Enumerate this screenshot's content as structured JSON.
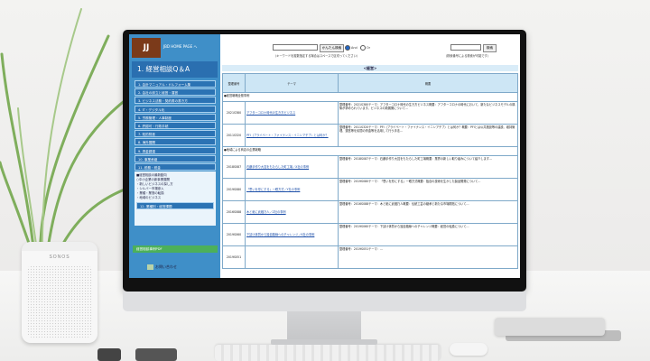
{
  "speaker": {
    "brand": "SONOS"
  },
  "sidebar": {
    "logo": "JJ",
    "home_link": "JBD HOME PAGE へ",
    "nav_title": "1. 経営相談Q＆A",
    "items": [
      "1. 会計マニュアル・ドルフォーム集",
      "2. 会社の設立と経営・運営",
      "3. ビジネス法務・契約書の書き方",
      "4. IT・デジタル化",
      "5. 労務管理・人事制度",
      "6. 許認可・行政手続",
      "7. 知的財産",
      "8. 海外展開",
      "9. 資金調達",
      "10. 事業承継",
      "11. 税務・税金",
      "12. 業種別・経営課題"
    ],
    "panel_lines": [
      "■経営相談の最新動向",
      "○中小企業の新事業展開",
      "・新しいビジネスの探し方",
      "・シルバー市場参入",
      "・業種・業態の転換",
      "・地域のビジネス"
    ],
    "green_button": "経営相談事例PDF",
    "contact": "お問い合わせ"
  },
  "search": {
    "button": "かんたん検索",
    "and_label": "And",
    "or_label": "Or",
    "note": "（キーワードを複数指定する場合はスペースで区切ってください）",
    "button2": "検索",
    "note2": "（検索番号による検索が可能です）"
  },
  "section_title": "<経営>",
  "table": {
    "col_id": "整理番号",
    "col_theme": "テーマ",
    "col_summary": "概要",
    "rows": [
      {
        "type": "cat",
        "label": "●経営戦略全般事例"
      },
      {
        "type": "row",
        "id": "2021S380",
        "theme": "アフターコロナ時代の生き方ビジネス",
        "summary": "整理番号：2021S380テーマ：アフターコロナ時代の生き方ビジネス概要：アフターコロナの時代において、新たなビジネスモデルの構築が求められています。ビジネスの新展開について…"
      },
      {
        "type": "row",
        "id": "2011S320",
        "theme": "PFI（プライベート・ファイナンス・イニシアチブ）とは何か？",
        "summary": "整理番号：2011S320テーマ：PFI（プライベート・ファイナンス・イニシアチブ）とは何か？概要：PFIとは公共施設等の建設、維持管理、運営等を民間の資金等を活用して行う手法…"
      },
      {
        "type": "cat",
        "label": "●地域による商店の企業戦略"
      },
      {
        "type": "row",
        "id": "2018S087",
        "theme": "石鹸手作り大賞をもたらした町工場／X社の事例",
        "summary": "整理番号：2018S087テーマ：石鹸手作り大賞をもたらした町工場概要：業界の新しい取り組みについて紹介します…"
      },
      {
        "type": "row",
        "id": "2019S080",
        "theme": "「思いを形にする」一眼方式／Y社の事例",
        "summary": "整理番号：2019S080テーマ：「思いを形にする」一眼方式概要：独自の技術を生かした製品開発について…"
      },
      {
        "type": "row",
        "id": "2016S088",
        "theme": "木と紙に武蔵乃人／Z社の事例",
        "summary": "整理番号：2016S088テーマ：木と紙に武蔵乃人概要：伝統工芸の継承と新たな市場開拓について…"
      },
      {
        "type": "row",
        "id": "2019S060",
        "theme": "下請け体質から独自路線へのチャレンジ／K社の事例",
        "summary": "整理番号：2019S060テーマ：下請け体質から独自路線へのチャレンジ概要：経営の転換について…"
      },
      {
        "type": "row",
        "id": "2019S051",
        "theme": "",
        "summary": "整理番号：2019S051テーマ：…"
      }
    ]
  }
}
